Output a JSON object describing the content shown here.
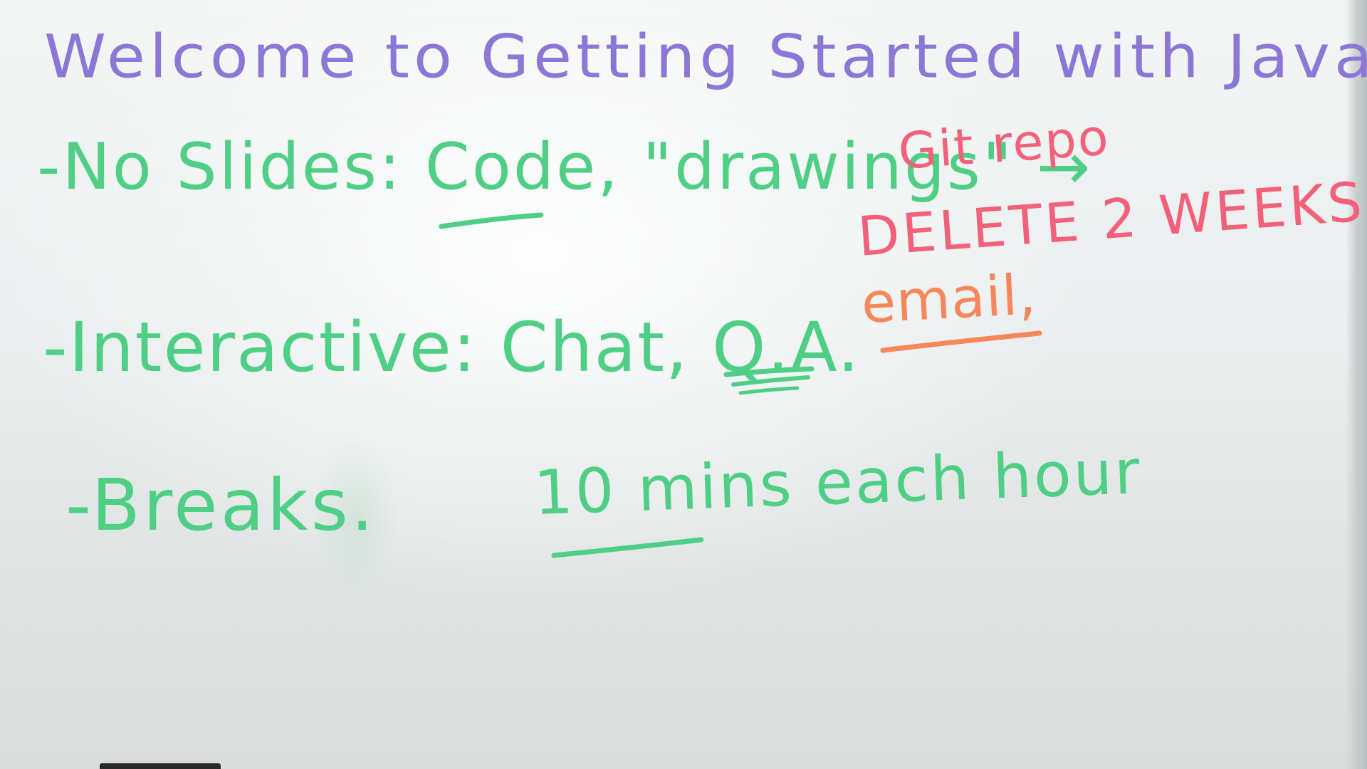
{
  "whiteboard": {
    "title": "Welcome to Getting Started with Java",
    "bullets": [
      {
        "text": "-No Slides: Code, \"drawings\" →"
      },
      {
        "text": "-Interactive: Chat, Q.A."
      },
      {
        "text": "-Breaks."
      }
    ],
    "annotations": {
      "git_repo": "Git repo",
      "delete_note": "DELETE 2 WEEKS",
      "email": "email,",
      "break_note": "10 mins each hour"
    },
    "ink_colors": {
      "title": "#8b78d6",
      "bullets": "#4fcf86",
      "git_repo": "#f2607a",
      "email": "#f6875a"
    }
  }
}
